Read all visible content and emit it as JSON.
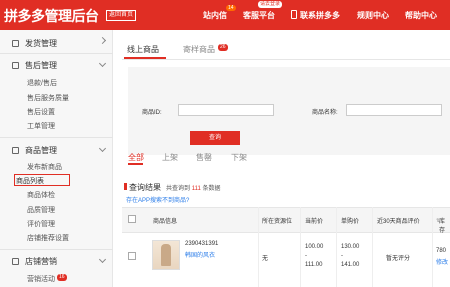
{
  "header": {
    "logo_text": "拼多多",
    "title": "管理后台",
    "back_home": "返回首页",
    "nav": {
      "inbox": "站内信",
      "inbox_badge": "14",
      "service_tip": "请去登录",
      "service": "客服平台",
      "contact": "联系拼多多",
      "rules": "规则中心",
      "help": "帮助中心"
    }
  },
  "sidebar": {
    "shipping": {
      "label": "发货管理"
    },
    "aftersale": {
      "label": "售后管理",
      "items": [
        "退款/售后",
        "售后服务质量",
        "售后设置",
        "工单管理"
      ]
    },
    "goods": {
      "label": "商品管理",
      "items": [
        "发布新商品",
        "商品列表",
        "商品体检",
        "品质管理",
        "评价管理",
        "店铺推荐设置"
      ]
    },
    "marketing": {
      "label": "店铺营销",
      "items": [
        "营销活动"
      ],
      "badge": "16"
    }
  },
  "tabs": {
    "online": "线上商品",
    "consignment": "寄样商品",
    "consignment_badge": "26"
  },
  "filter": {
    "goods_id_label": "商品ID:",
    "goods_name_label": "商品名称:",
    "query_button": "查询"
  },
  "status_tabs": [
    "全部",
    "上架",
    "售罄",
    "下架"
  ],
  "results": {
    "title": "查询结果",
    "info_prefix": "共查询到",
    "count": "111",
    "info_suffix": "条数据",
    "unmapped_link": "存在APP搜索不到商品?"
  },
  "table": {
    "headers": [
      "商品信息",
      "所在资源位",
      "当前价",
      "单购价",
      "近30天商品评价",
      "库存"
    ],
    "rows": [
      {
        "goods_id": "2390431391",
        "goods_name": "韩国的风衣",
        "resource": "无",
        "current_price": [
          "100.00",
          "111.00"
        ],
        "single_price": [
          "130.00",
          "141.00"
        ],
        "review": "暂无评分",
        "stock": "780",
        "stock_action": "修改"
      }
    ]
  }
}
